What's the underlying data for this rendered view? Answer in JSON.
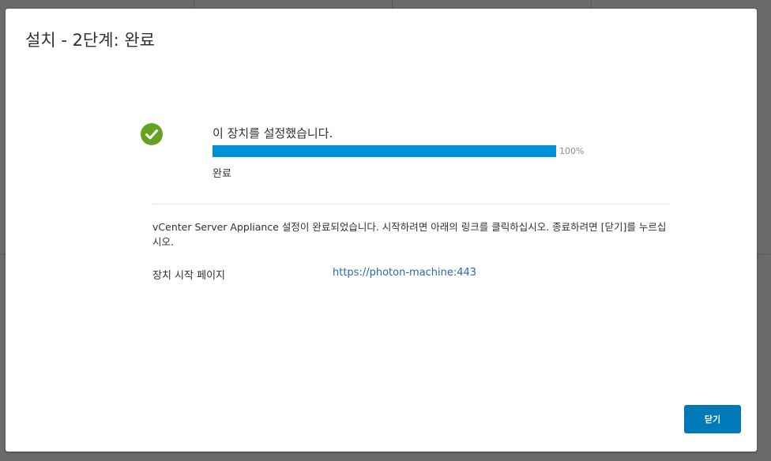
{
  "dialog": {
    "title": "설치 - 2단계: 완료"
  },
  "status": {
    "icon": "check-circle-icon",
    "icon_color": "#62a420",
    "message": "이 장치를 설정했습니다.",
    "progress_percent": 100,
    "progress_text": "100%",
    "progress_color": "#0090d5",
    "state_label": "완료"
  },
  "completion": {
    "message": "vCenter Server Appliance 설정이 완료되었습니다. 시작하려면 아래의 링크를 클릭하십시오. 종료하려면 [닫기]를 누르십시오.",
    "appliance_page_label": "장치 시작 페이지",
    "appliance_page_url": "https://photon-machine:443"
  },
  "footer": {
    "close_label": "닫기",
    "close_color": "#0079b8"
  }
}
